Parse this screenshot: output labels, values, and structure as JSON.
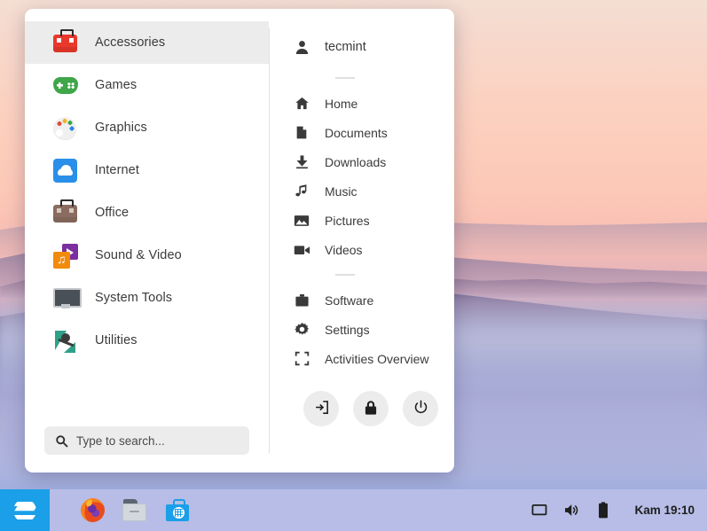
{
  "desktop": {
    "wallpaper_description": "sunrise-mountain-fog"
  },
  "menu": {
    "categories": [
      {
        "label": "Accessories",
        "icon": "toolbox-icon",
        "active": true
      },
      {
        "label": "Games",
        "icon": "gamepad-icon",
        "active": false
      },
      {
        "label": "Graphics",
        "icon": "palette-icon",
        "active": false
      },
      {
        "label": "Internet",
        "icon": "cloud-icon",
        "active": false
      },
      {
        "label": "Office",
        "icon": "briefcase-icon",
        "active": false
      },
      {
        "label": "Sound & Video",
        "icon": "media-icon",
        "active": false
      },
      {
        "label": "System Tools",
        "icon": "monitor-icon",
        "active": false
      },
      {
        "label": "Utilities",
        "icon": "utilities-icon",
        "active": false
      }
    ],
    "search": {
      "placeholder": "Type to search...",
      "value": "",
      "icon": "search-icon"
    },
    "user": {
      "name": "tecmint",
      "icon": "user-avatar-icon"
    },
    "places": [
      {
        "label": "Home",
        "icon": "home-icon"
      },
      {
        "label": "Documents",
        "icon": "document-icon"
      },
      {
        "label": "Downloads",
        "icon": "download-icon"
      },
      {
        "label": "Music",
        "icon": "music-note-icon"
      },
      {
        "label": "Pictures",
        "icon": "picture-icon"
      },
      {
        "label": "Videos",
        "icon": "video-camera-icon"
      }
    ],
    "system": [
      {
        "label": "Software",
        "icon": "briefcase-icon"
      },
      {
        "label": "Settings",
        "icon": "gear-icon"
      },
      {
        "label": "Activities Overview",
        "icon": "expand-icon"
      }
    ],
    "session_buttons": [
      {
        "name": "logout",
        "icon": "logout-icon"
      },
      {
        "name": "lock",
        "icon": "lock-icon"
      },
      {
        "name": "power",
        "icon": "power-icon"
      }
    ]
  },
  "taskbar": {
    "start_button": {
      "icon": "zorin-logo-icon"
    },
    "launchers": [
      {
        "name": "firefox",
        "icon": "firefox-icon"
      },
      {
        "name": "files",
        "icon": "file-manager-icon"
      },
      {
        "name": "software",
        "icon": "software-store-icon"
      }
    ],
    "tray": [
      {
        "name": "display",
        "icon": "display-icon"
      },
      {
        "name": "volume",
        "icon": "volume-icon"
      },
      {
        "name": "battery",
        "icon": "battery-icon"
      }
    ],
    "clock": "Kam 19:10"
  },
  "colors": {
    "accent": "#1a9fe8",
    "taskbar": "#b7bde6",
    "panel": "#ffffff",
    "highlight": "#ececec",
    "text": "#3b3b3b"
  }
}
